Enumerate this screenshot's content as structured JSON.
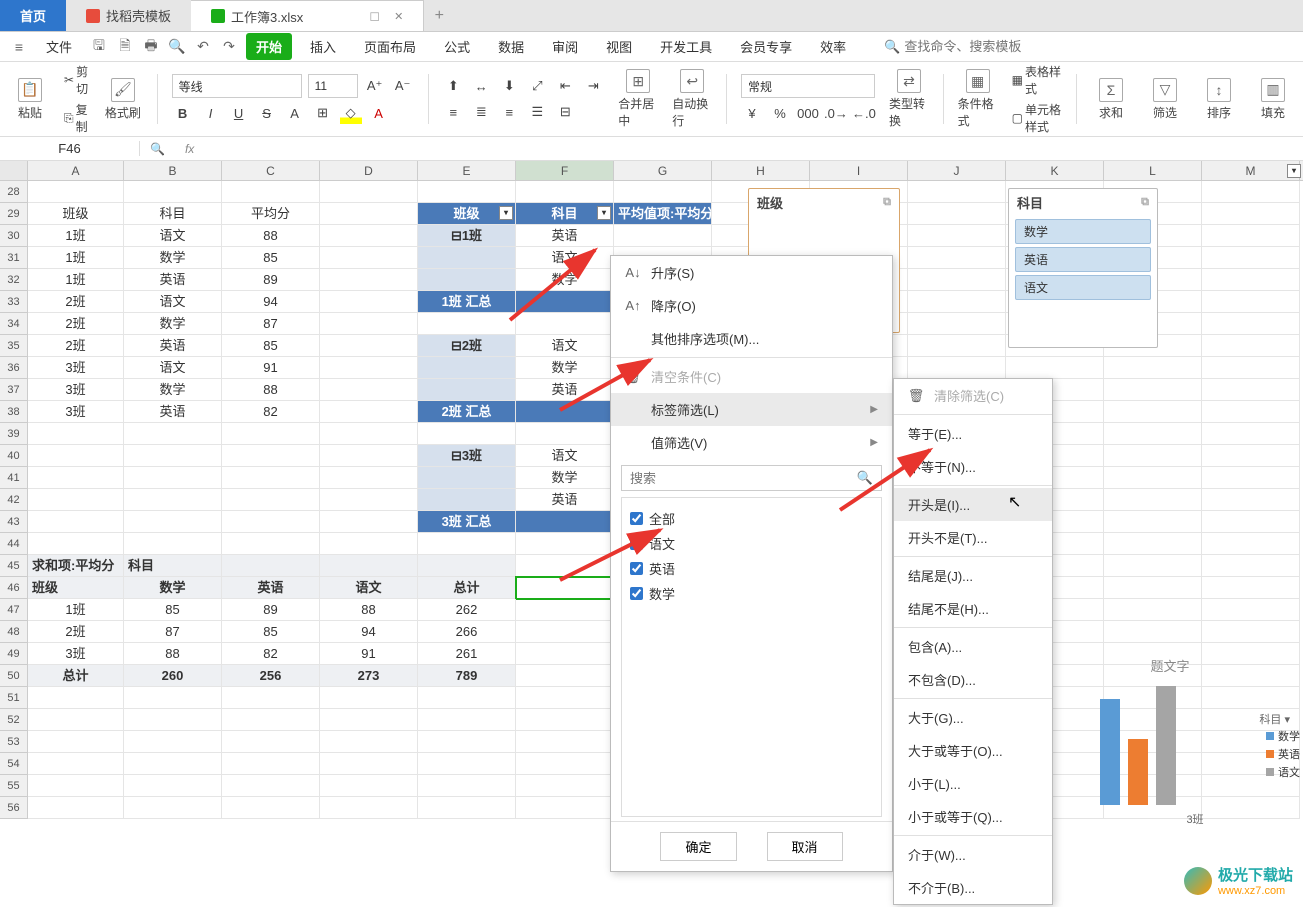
{
  "tabs": {
    "home": "首页",
    "template": "找稻壳模板",
    "doc": "工作簿3.xlsx"
  },
  "menubar": {
    "file": "文件",
    "items": [
      "开始",
      "插入",
      "页面布局",
      "公式",
      "数据",
      "审阅",
      "视图",
      "开发工具",
      "会员专享",
      "效率"
    ],
    "search_placeholder": "查找命令、搜索模板"
  },
  "ribbon": {
    "paste": "粘贴",
    "cut": "剪切",
    "copy": "复制",
    "format_painter": "格式刷",
    "font": "等线",
    "size": "11",
    "merge": "合并居中",
    "wrap": "自动换行",
    "number_format": "常规",
    "type_convert": "类型转换",
    "cond_format": "条件格式",
    "table_style": "表格样式",
    "cell_style": "单元格样式",
    "sum": "求和",
    "filter": "筛选",
    "sort": "排序",
    "fill": "填充"
  },
  "name_box": "F46",
  "col_headers": [
    "A",
    "B",
    "C",
    "D",
    "E",
    "F",
    "G",
    "H",
    "I",
    "J",
    "K",
    "L",
    "M"
  ],
  "row_start": 28,
  "data_table": {
    "headers": [
      "班级",
      "科目",
      "平均分"
    ],
    "rows": [
      [
        "1班",
        "语文",
        "88"
      ],
      [
        "1班",
        "数学",
        "85"
      ],
      [
        "1班",
        "英语",
        "89"
      ],
      [
        "2班",
        "语文",
        "94"
      ],
      [
        "2班",
        "数学",
        "87"
      ],
      [
        "2班",
        "英语",
        "85"
      ],
      [
        "3班",
        "语文",
        "91"
      ],
      [
        "3班",
        "数学",
        "88"
      ],
      [
        "3班",
        "英语",
        "82"
      ]
    ]
  },
  "pivot1": {
    "headers": [
      "班级",
      "科目",
      "平均值项:平均分"
    ],
    "groups": [
      {
        "name": "1班",
        "items": [
          "英语",
          "语文",
          "数学"
        ],
        "total": "1班 汇总"
      },
      {
        "name": "2班",
        "items": [
          "语文",
          "数学",
          "英语"
        ],
        "total": "2班 汇总"
      },
      {
        "name": "3班",
        "items": [
          "语文",
          "数学",
          "英语"
        ],
        "total": "3班 汇总"
      }
    ],
    "collapse": "⊟"
  },
  "pivot2": {
    "row_label": "求和项:平均分",
    "col_label": "科目",
    "row_field": "班级",
    "cols": [
      "数学",
      "英语",
      "语文",
      "总计"
    ],
    "rows": [
      {
        "k": "1班",
        "v": [
          "85",
          "89",
          "88",
          "262"
        ]
      },
      {
        "k": "2班",
        "v": [
          "87",
          "85",
          "94",
          "266"
        ]
      },
      {
        "k": "3班",
        "v": [
          "88",
          "82",
          "91",
          "261"
        ]
      }
    ],
    "total_label": "总计",
    "totals": [
      "260",
      "256",
      "273",
      "789"
    ]
  },
  "filter_menu": {
    "sort_asc": "升序(S)",
    "sort_desc": "降序(O)",
    "more_sort": "其他排序选项(M)...",
    "clear": "清空条件(C)",
    "label_filter": "标签筛选(L)",
    "value_filter": "值筛选(V)",
    "search_placeholder": "搜索",
    "checks": [
      "全部",
      "语文",
      "英语",
      "数学"
    ],
    "ok": "确定",
    "cancel": "取消"
  },
  "submenu": {
    "clear": "清除筛选(C)",
    "items": [
      "等于(E)...",
      "不等于(N)...",
      "开头是(I)...",
      "开头不是(T)...",
      "结尾是(J)...",
      "结尾不是(H)...",
      "包含(A)...",
      "不包含(D)...",
      "大于(G)...",
      "大于或等于(O)...",
      "小于(L)...",
      "小于或等于(Q)...",
      "介于(W)...",
      "不介于(B)..."
    ]
  },
  "slicer_class": {
    "title": "班级"
  },
  "slicer_subject": {
    "title": "科目",
    "items": [
      "数学",
      "英语",
      "语文"
    ]
  },
  "chart_data": {
    "type": "bar",
    "title": "题文字",
    "categories": [
      "3班"
    ],
    "series": [
      {
        "name": "数学",
        "value": 88,
        "color": "#5a9bd5"
      },
      {
        "name": "英语",
        "value": 82,
        "color": "#ed7d31"
      },
      {
        "name": "语文",
        "value": 91,
        "color": "#a5a5a5"
      }
    ],
    "legend_title": "科目",
    "ylim": [
      0,
      100
    ]
  },
  "watermark": {
    "cn": "极光下载站",
    "en": "www.xz7.com"
  }
}
